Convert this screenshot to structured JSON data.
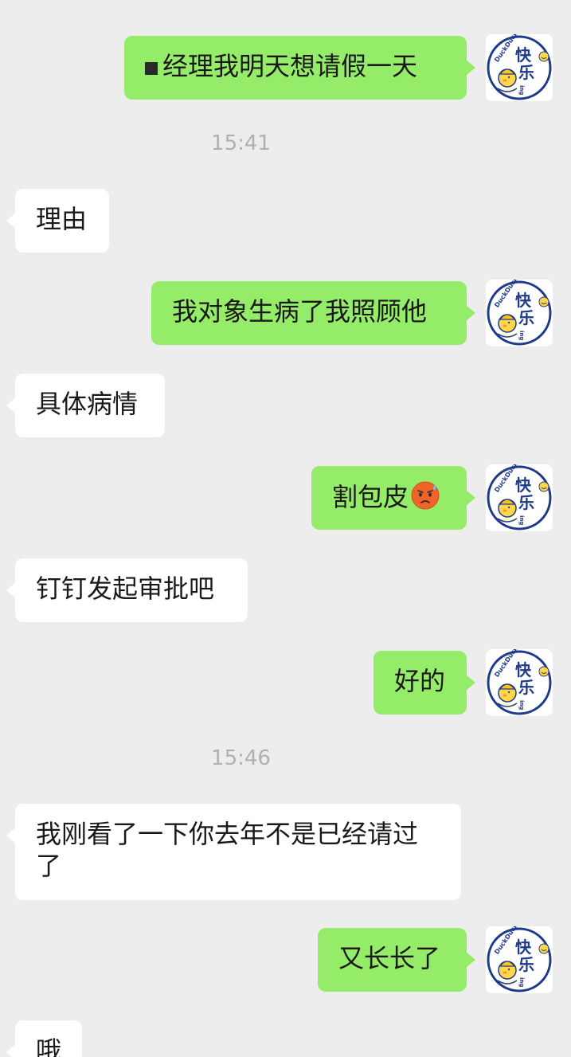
{
  "messages": [
    {
      "text": "经理我明天想请假一天"
    },
    {
      "text": "理由"
    },
    {
      "text": "我对象生病了我照顾他"
    },
    {
      "text": "具体病情"
    },
    {
      "text": "割包皮"
    },
    {
      "text": "钉钉发起审批吧"
    },
    {
      "text": "好的"
    },
    {
      "text": "我刚看了一下你去年不是已经请过了"
    },
    {
      "text": "又长长了"
    },
    {
      "text": "哦"
    }
  ],
  "timestamps": [
    "15:41",
    "15:46"
  ],
  "avatar": {
    "icon": "duck-avatar-icon",
    "text_main_1": "快",
    "text_main_2": "乐",
    "text_side": "DuckDuck",
    "text_ing": "ing"
  },
  "emoji": {
    "icon": "sweat-face-icon"
  },
  "colors": {
    "background": "#EDEDED",
    "outgoing_bubble": "#95EC69",
    "incoming_bubble": "#FFFFFF",
    "timestamp_text": "#B0B0B0"
  }
}
